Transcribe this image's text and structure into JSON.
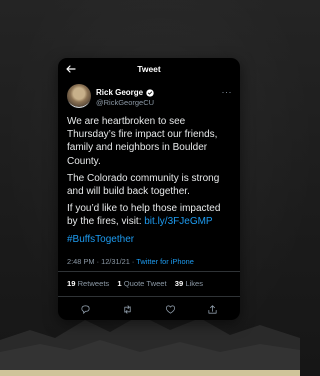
{
  "nav": {
    "title": "Tweet"
  },
  "author": {
    "name": "Rick George",
    "handle": "@RickGeorgeCU"
  },
  "tweet": {
    "para1": "We are heartbroken to see Thursday’s fire impact our friends, family and neighbors in Boulder County.",
    "para2": "The Colorado community is strong and will build back together.",
    "para3_text": "If you’d like to help those impacted by the fires, visit: ",
    "link": "bit.ly/3FJeGMP",
    "hashtag": "#BuffsTogether"
  },
  "meta": {
    "timestamp": "2:48 PM · 12/31/21 · ",
    "source": "Twitter for iPhone"
  },
  "stats": {
    "retweets_count": "19",
    "retweets_label": "Retweets",
    "quotes_count": "1",
    "quotes_label": "Quote Tweet",
    "likes_count": "39",
    "likes_label": "Likes"
  },
  "colors": {
    "accent": "#1d9bf0",
    "card_bg": "#000000",
    "bottom_strip": "#cfc49a"
  },
  "icons": [
    "back-arrow-icon",
    "verified-badge-icon",
    "more-icon",
    "reply-icon",
    "retweet-icon",
    "like-icon",
    "share-icon"
  ]
}
